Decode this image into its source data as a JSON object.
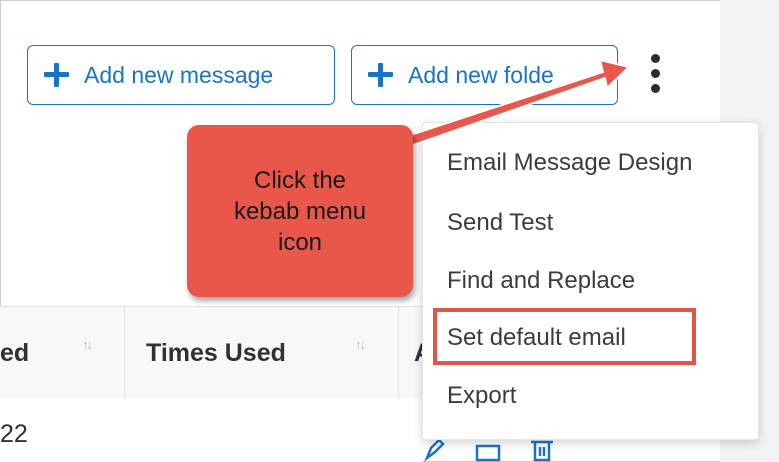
{
  "toolbar": {
    "add_message_label": "Add new message",
    "add_folder_label": "Add new folde"
  },
  "table": {
    "headers": [
      "ed",
      "Times Used",
      "A"
    ],
    "first_row_text": "22"
  },
  "menu": {
    "items": [
      "Email Message Design",
      "Send Test",
      "Find and Replace",
      "Set default email",
      "Export"
    ]
  },
  "callout": {
    "text": "Click the\nkebab menu\nicon"
  },
  "colors": {
    "accent": "#1a73c8",
    "callout": "#e8574a",
    "highlight": "#e05545"
  },
  "icons": [
    "plus-icon",
    "kebab-menu-icon",
    "sort-icon",
    "edit-icon",
    "copy-icon",
    "delete-icon"
  ]
}
